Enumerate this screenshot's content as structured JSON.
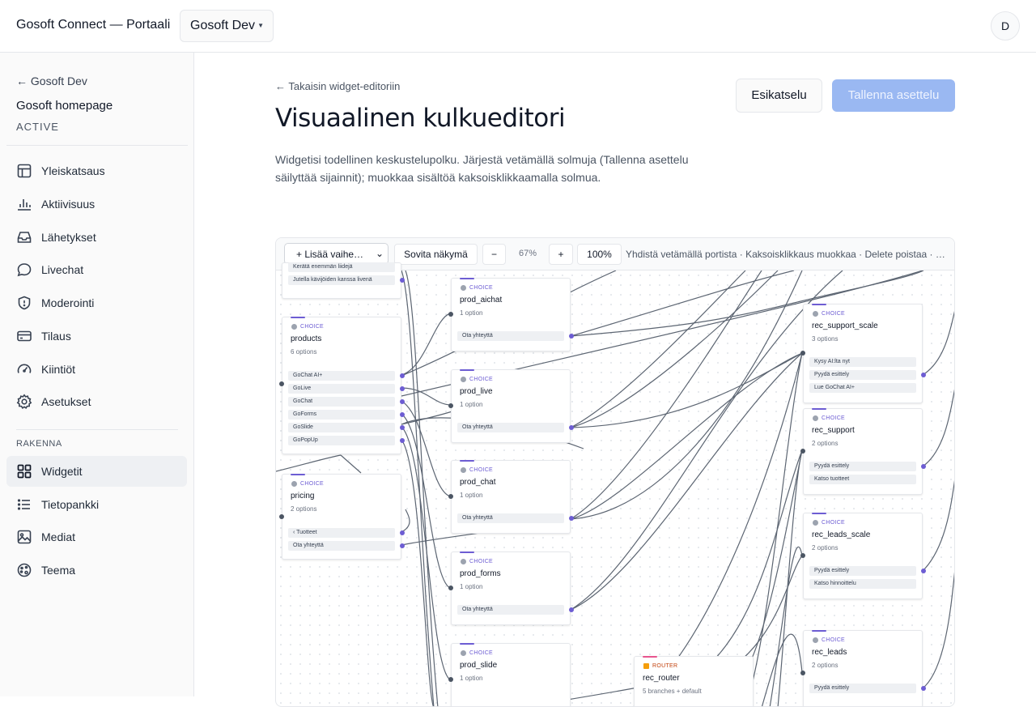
{
  "app": {
    "title": "Gosoft Connect — Portaali",
    "workspace": "Gosoft Dev",
    "user_initial": "D"
  },
  "sidebar": {
    "back_label": "← Gosoft Dev",
    "site_name": "Gosoft homepage",
    "site_status": "ACTIVE",
    "items": [
      {
        "label": "Yleiskatsaus",
        "icon": "table-icon"
      },
      {
        "label": "Aktiivisuus",
        "icon": "bar-chart-icon"
      },
      {
        "label": "Lähetykset",
        "icon": "inbox-icon"
      },
      {
        "label": "Livechat",
        "icon": "chat-bubble-icon"
      },
      {
        "label": "Moderointi",
        "icon": "shield-icon"
      },
      {
        "label": "Tilaus",
        "icon": "credit-card-icon"
      },
      {
        "label": "Kiintiöt",
        "icon": "gauge-icon"
      },
      {
        "label": "Asetukset",
        "icon": "gear-icon"
      }
    ],
    "section_label": "RAKENNA",
    "build_items": [
      {
        "label": "Widgetit",
        "icon": "grid-icon",
        "active": true
      },
      {
        "label": "Tietopankki",
        "icon": "list-icon"
      },
      {
        "label": "Mediat",
        "icon": "image-icon"
      },
      {
        "label": "Teema",
        "icon": "palette-icon"
      }
    ]
  },
  "main": {
    "back_label": "← Takaisin widget-editoriin",
    "title": "Visuaalinen kulkueditori",
    "description": "Widgetisi todellinen keskustelupolku. Järjestä vetämällä solmuja (Tallenna asettelu säilyttää sijainnit); muokkaa sisältöä kaksoisklikkaamalla solmua.",
    "preview_label": "Esikatselu",
    "save_label": "Tallenna asettelu"
  },
  "toolbar": {
    "add_step": "+ Lisää vaihe…",
    "fit_view": "Sovita näkymä",
    "zoom_out": "−",
    "zoom_level": "67%",
    "zoom_in": "+",
    "zoom_reset": "100%",
    "hint": "Yhdistä vetämällä portista · Kaksoisklikkaus muokkaa · Delete poistaa · …"
  },
  "flow": {
    "accent_color": "#6d5dd3",
    "partial_node": {
      "options": [
        "Kerätä enemmän liidejä",
        "Jutella kävijöiden kanssa livenä"
      ]
    },
    "nodes": [
      {
        "id": "products",
        "kind": "CHOICE",
        "name": "products",
        "sub": "6 options",
        "options": [
          "GoChat AI+",
          "GoLive",
          "GoChat",
          "GoForms",
          "GoSlide",
          "GoPopUp"
        ]
      },
      {
        "id": "pricing",
        "kind": "CHOICE",
        "name": "pricing",
        "sub": "2 options",
        "options": [
          "‹ Tuotteet",
          "Ota yhteyttä"
        ]
      },
      {
        "id": "prod_aichat",
        "kind": "CHOICE",
        "name": "prod_aichat",
        "sub": "1 option",
        "options": [
          "Ota yhteyttä"
        ]
      },
      {
        "id": "prod_live",
        "kind": "CHOICE",
        "name": "prod_live",
        "sub": "1 option",
        "options": [
          "Ota yhteyttä"
        ]
      },
      {
        "id": "prod_chat",
        "kind": "CHOICE",
        "name": "prod_chat",
        "sub": "1 option",
        "options": [
          "Ota yhteyttä"
        ]
      },
      {
        "id": "prod_forms",
        "kind": "CHOICE",
        "name": "prod_forms",
        "sub": "1 option",
        "options": [
          "Ota yhteyttä"
        ]
      },
      {
        "id": "prod_slide",
        "kind": "CHOICE",
        "name": "prod_slide",
        "sub": "1 option",
        "options": []
      },
      {
        "id": "rec_router",
        "kind": "ROUTER",
        "name": "rec_router",
        "sub": "5 branches + default",
        "options": []
      },
      {
        "id": "rec_support_scale",
        "kind": "CHOICE",
        "name": "rec_support_scale",
        "sub": "3 options",
        "options": [
          "Kysy AI:lta nyt",
          "Pyydä esittely",
          "Lue GoChat AI+"
        ]
      },
      {
        "id": "rec_support",
        "kind": "CHOICE",
        "name": "rec_support",
        "sub": "2 options",
        "options": [
          "Pyydä esittely",
          "Katso tuotteet"
        ]
      },
      {
        "id": "rec_leads_scale",
        "kind": "CHOICE",
        "name": "rec_leads_scale",
        "sub": "2 options",
        "options": [
          "Pyydä esittely",
          "Katso hinnoittelu"
        ]
      },
      {
        "id": "rec_leads",
        "kind": "CHOICE",
        "name": "rec_leads",
        "sub": "2 options",
        "options": [
          "Pyydä esittely"
        ]
      }
    ]
  }
}
